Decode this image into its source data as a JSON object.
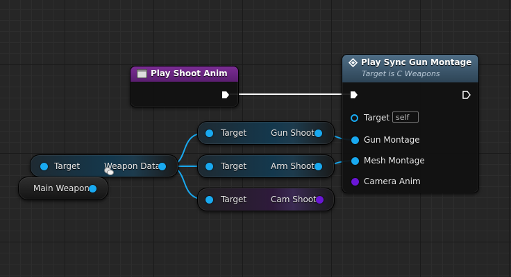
{
  "play_shoot_anim": {
    "title": "Play Shoot Anim"
  },
  "play_sync": {
    "title": "Play Sync Gun Montage",
    "subtitle": "Target is C Weapons",
    "pins": {
      "target": "Target",
      "target_default": "self",
      "gun_montage": "Gun Montage",
      "mesh_montage": "Mesh Montage",
      "camera_anim": "Camera Anim"
    }
  },
  "weapon_data_node": {
    "input": "Target",
    "output": "Weapon Data"
  },
  "main_weapon_node": {
    "output": "Main Weapon"
  },
  "gun_shoot_node": {
    "input": "Target",
    "output": "Gun Shoot"
  },
  "arm_shoot_node": {
    "input": "Target",
    "output": "Arm Shoot"
  },
  "cam_shoot_node": {
    "input": "Target",
    "output": "Cam Shoot"
  },
  "colors": {
    "data_pin": "#19a9f0",
    "anim_pin": "#6a16d6",
    "exec_pin": "#ffffff",
    "function_header": "#7b2d94",
    "call_header": "#4f6e86"
  }
}
